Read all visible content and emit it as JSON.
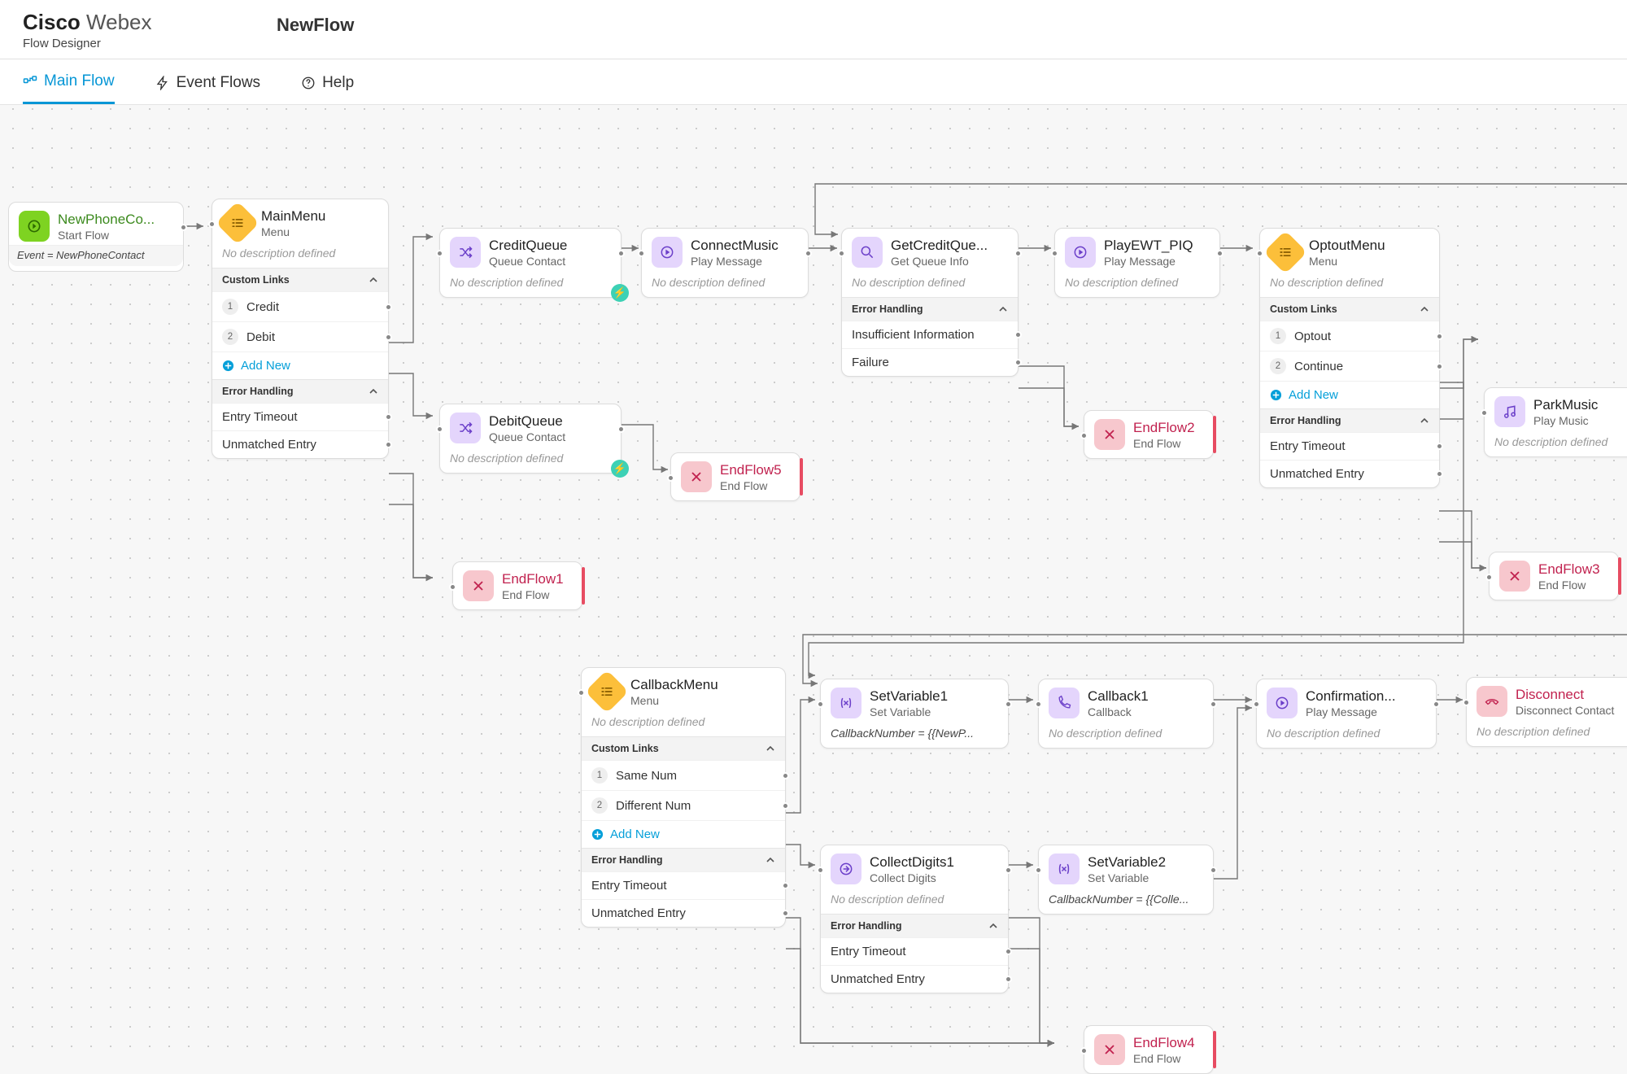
{
  "header": {
    "brand_bold": "Cisco",
    "brand_light": "Webex",
    "subtitle": "Flow Designer",
    "flow_name": "NewFlow"
  },
  "tabs": {
    "main": "Main Flow",
    "events": "Event Flows",
    "help": "Help"
  },
  "labels": {
    "no_desc": "No description defined",
    "custom_links": "Custom Links",
    "error_handling": "Error Handling",
    "add_new": "Add New",
    "entry_timeout": "Entry Timeout",
    "unmatched": "Unmatched Entry",
    "insufficient": "Insufficient Information",
    "failure": "Failure"
  },
  "start": {
    "title": "NewPhoneCo...",
    "sub": "Start Flow",
    "expr": "Event = NewPhoneContact"
  },
  "nodes": {
    "mainmenu": {
      "title": "MainMenu",
      "sub": "Menu",
      "links": [
        "Credit",
        "Debit"
      ]
    },
    "creditq": {
      "title": "CreditQueue",
      "sub": "Queue Contact"
    },
    "debitq": {
      "title": "DebitQueue",
      "sub": "Queue Contact"
    },
    "connectmusic": {
      "title": "ConnectMusic",
      "sub": "Play Message"
    },
    "getcredit": {
      "title": "GetCreditQue...",
      "sub": "Get Queue Info"
    },
    "playewt": {
      "title": "PlayEWT_PIQ",
      "sub": "Play Message"
    },
    "optout": {
      "title": "OptoutMenu",
      "sub": "Menu",
      "links": [
        "Optout",
        "Continue"
      ]
    },
    "parkmusic": {
      "title": "ParkMusic",
      "sub": "Play Music"
    },
    "endflow1": {
      "title": "EndFlow1",
      "sub": "End Flow"
    },
    "endflow2": {
      "title": "EndFlow2",
      "sub": "End Flow"
    },
    "endflow3": {
      "title": "EndFlow3",
      "sub": "End Flow"
    },
    "endflow4": {
      "title": "EndFlow4",
      "sub": "End Flow"
    },
    "endflow5": {
      "title": "EndFlow5",
      "sub": "End Flow"
    },
    "callbackmenu": {
      "title": "CallbackMenu",
      "sub": "Menu",
      "links": [
        "Same Num",
        "Different Num"
      ]
    },
    "setvar1": {
      "title": "SetVariable1",
      "sub": "Set Variable",
      "expr": "CallbackNumber = {{NewP..."
    },
    "setvar2": {
      "title": "SetVariable2",
      "sub": "Set Variable",
      "expr": "CallbackNumber = {{Colle..."
    },
    "collectdigits": {
      "title": "CollectDigits1",
      "sub": "Collect Digits"
    },
    "callback1": {
      "title": "Callback1",
      "sub": "Callback"
    },
    "confirmation": {
      "title": "Confirmation...",
      "sub": "Play Message"
    },
    "disconnect": {
      "title": "Disconnect",
      "sub": "Disconnect Contact"
    }
  }
}
